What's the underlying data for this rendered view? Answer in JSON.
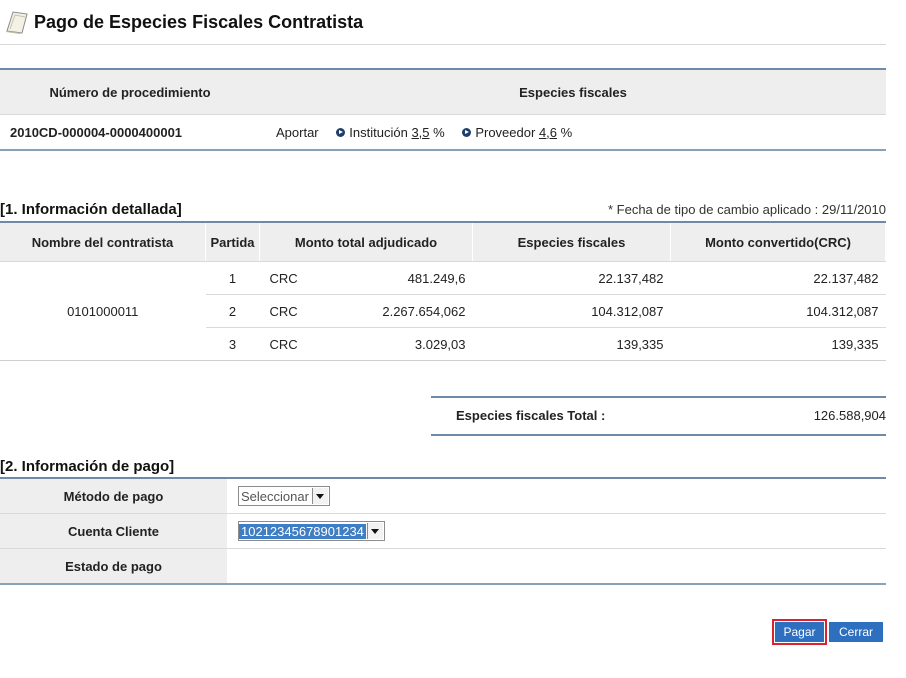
{
  "header": {
    "title": "Pago de Especies Fiscales Contratista",
    "icon": "document-icon"
  },
  "procedure": {
    "col_number": "Número de procedimiento",
    "col_species": "Especies fiscales",
    "number": "2010CD-000004-0000400001",
    "contribute_label": "Aportar",
    "institution_label": "Institución",
    "institution_pct": "3,5",
    "supplier_label": "Proveedor",
    "supplier_pct": "4,6",
    "pct_symbol": "%"
  },
  "detail": {
    "section_title": "[1. Información detallada]",
    "exchange_note": "* Fecha de tipo de cambio aplicado : 29/11/2010",
    "columns": [
      "Nombre del contratista",
      "Partida",
      "Monto total adjudicado",
      "Especies fiscales",
      "Monto convertido(CRC)"
    ],
    "contractor": "0101000011",
    "rows": [
      {
        "partida": "1",
        "currency": "CRC",
        "amount": "481.249,6",
        "species": "22.137,482",
        "converted": "22.137,482"
      },
      {
        "partida": "2",
        "currency": "CRC",
        "amount": "2.267.654,062",
        "species": "104.312,087",
        "converted": "104.312,087"
      },
      {
        "partida": "3",
        "currency": "CRC",
        "amount": "3.029,03",
        "species": "139,335",
        "converted": "139,335"
      }
    ]
  },
  "total": {
    "label": "Especies fiscales Total :",
    "value": "126.588,904"
  },
  "payment": {
    "section_title": "[2. Información de pago]",
    "method_label": "Método de pago",
    "method_value": "Seleccionar",
    "account_label": "Cuenta Cliente",
    "account_value": "10212345678901234",
    "status_label": "Estado de pago",
    "status_value": ""
  },
  "buttons": {
    "pay": "Pagar",
    "close": "Cerrar"
  },
  "colors": {
    "accent": "#2f6fc0",
    "highlight": "#d9232e"
  }
}
